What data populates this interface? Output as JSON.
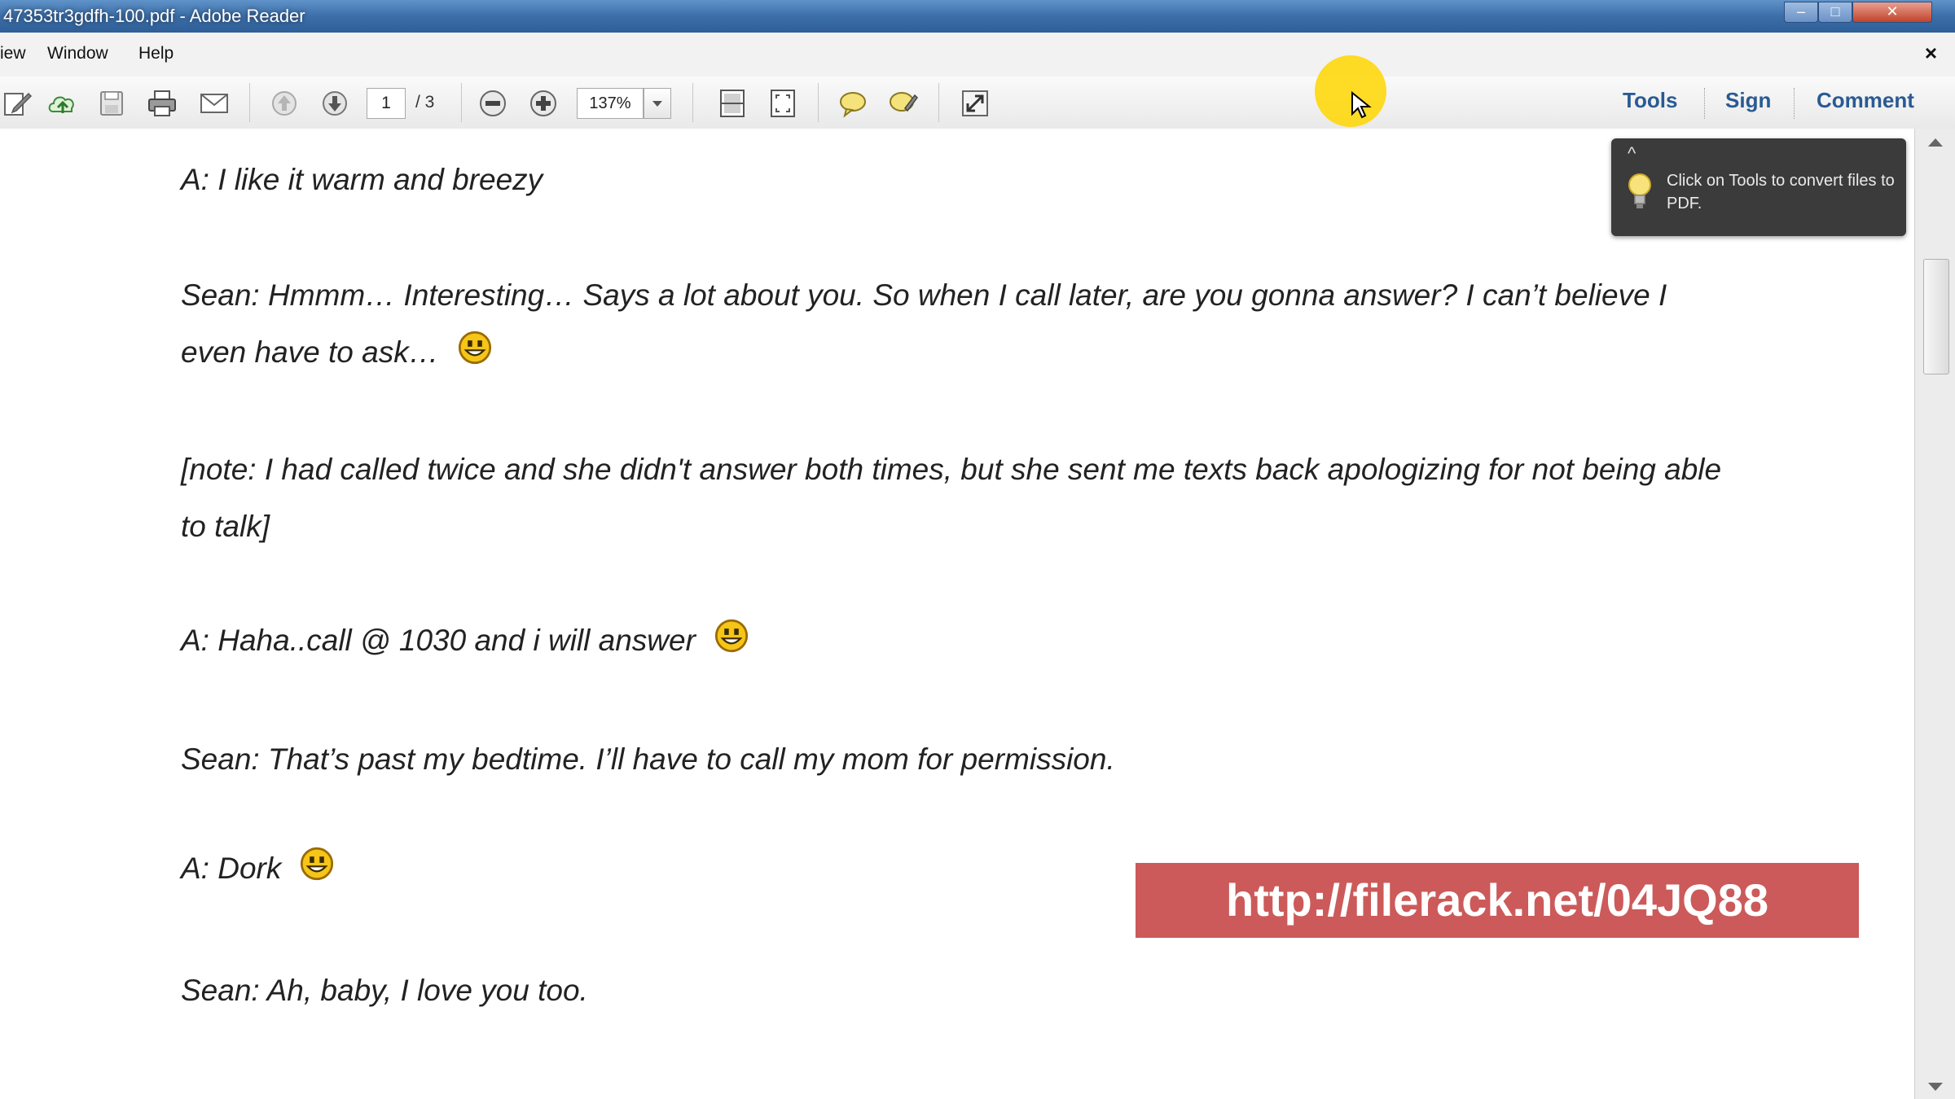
{
  "window": {
    "title": "47353tr3gdfh-100.pdf - Adobe Reader"
  },
  "menu": {
    "items": [
      "iew",
      "Window",
      "Help"
    ],
    "close_glyph": "×"
  },
  "toolbar": {
    "current_page": "1",
    "page_count": "/ 3",
    "zoom": "137%",
    "tools_label": "Tools",
    "sign_label": "Sign",
    "comment_label": "Comment",
    "icons": [
      "create-icon",
      "upload-icon",
      "save-icon",
      "print-icon",
      "email-icon",
      "page-up-icon",
      "page-down-icon",
      "zoom-out-icon",
      "zoom-in-icon",
      "fit-page-icon",
      "fit-width-icon",
      "comment-icon",
      "highlight-icon",
      "fullscreen-icon"
    ]
  },
  "tooltip": {
    "text": "Click on Tools to convert files to PDF."
  },
  "document": {
    "paragraphs": [
      "A: I like it warm and breezy",
      "Sean: Hmmm… Interesting… Says a lot about you. So when I call later, are you gonna answer? I can’t believe I even have to ask…",
      "[note: I had called twice and she didn't answer both times, but she sent me texts back apologizing for not being able to talk]",
      "A: Haha..call @ 1030 and i will answer",
      "Sean: That’s past my bedtime. I’ll have to call my mom for permission.",
      "A: Dork",
      "Sean: Ah, baby, I love you too."
    ]
  },
  "watermark": {
    "url": "http://filerack.net/04JQ88"
  },
  "colors": {
    "titlebar": "#3c6ea8",
    "link_blue": "#2a5a93",
    "watermark_bg": "#cc5a5a",
    "cursor_highlight": "#ffd600"
  }
}
